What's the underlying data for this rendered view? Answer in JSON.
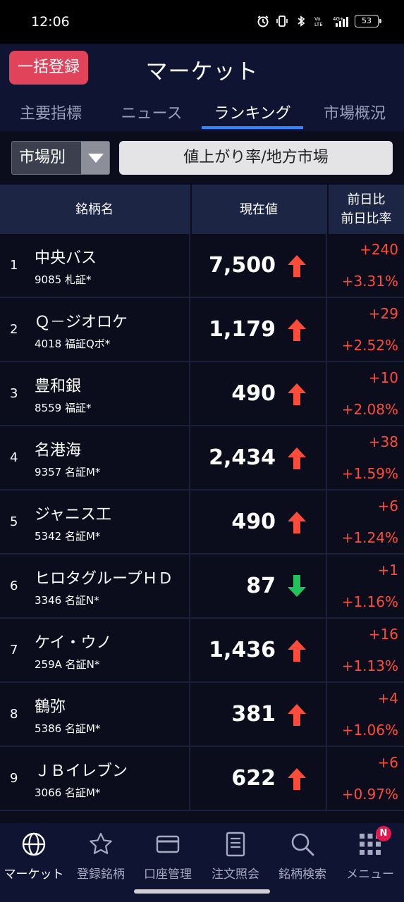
{
  "status": {
    "time": "12:06",
    "battery": "53",
    "network": "4G+"
  },
  "appbar": {
    "bulk_button": "一括登録",
    "title": "マーケット"
  },
  "tabs": [
    {
      "label": "主要指標"
    },
    {
      "label": "ニュース"
    },
    {
      "label": "ランキング"
    },
    {
      "label": "市場概況"
    }
  ],
  "filter": {
    "market_select": "市場別",
    "ranking_type": "値上がり率/地方市場"
  },
  "table": {
    "headers": {
      "name": "銘柄名",
      "price": "現在値",
      "change_line1": "前日比",
      "change_line2": "前日比率"
    },
    "rows": [
      {
        "rank": "1",
        "name": "中央バス",
        "code": "9085 札証*",
        "price": "7,500",
        "direction": "up",
        "change": "+240",
        "change_pct": "+3.31%"
      },
      {
        "rank": "2",
        "name": "Ｑ－ジオロケ",
        "code": "4018 福証Qボ*",
        "price": "1,179",
        "direction": "up",
        "change": "+29",
        "change_pct": "+2.52%"
      },
      {
        "rank": "3",
        "name": "豊和銀",
        "code": "8559 福証*",
        "price": "490",
        "direction": "up",
        "change": "+10",
        "change_pct": "+2.08%"
      },
      {
        "rank": "4",
        "name": "名港海",
        "code": "9357 名証M*",
        "price": "2,434",
        "direction": "up",
        "change": "+38",
        "change_pct": "+1.59%"
      },
      {
        "rank": "5",
        "name": "ジャニス工",
        "code": "5342 名証M*",
        "price": "490",
        "direction": "up",
        "change": "+6",
        "change_pct": "+1.24%"
      },
      {
        "rank": "6",
        "name": "ヒロタグループＨＤ",
        "code": "3346 名証N*",
        "price": "87",
        "direction": "down",
        "change": "+1",
        "change_pct": "+1.16%"
      },
      {
        "rank": "7",
        "name": "ケイ・ウノ",
        "code": "259A 名証N*",
        "price": "1,436",
        "direction": "up",
        "change": "+16",
        "change_pct": "+1.13%"
      },
      {
        "rank": "8",
        "name": "鶴弥",
        "code": "5386 名証M*",
        "price": "381",
        "direction": "up",
        "change": "+4",
        "change_pct": "+1.06%"
      },
      {
        "rank": "9",
        "name": "ＪＢイレブン",
        "code": "3066 名証M*",
        "price": "622",
        "direction": "up",
        "change": "+6",
        "change_pct": "+0.97%"
      }
    ]
  },
  "bottom_nav": [
    {
      "label": "マーケット",
      "icon": "globe-icon",
      "active": true
    },
    {
      "label": "登録銘柄",
      "icon": "star-icon"
    },
    {
      "label": "口座管理",
      "icon": "card-icon"
    },
    {
      "label": "注文照会",
      "icon": "document-icon"
    },
    {
      "label": "銘柄検索",
      "icon": "search-icon"
    },
    {
      "label": "メニュー",
      "icon": "grid-menu-icon",
      "badge": "N"
    }
  ],
  "colors": {
    "up": "#ff4b3a",
    "down": "#22c35a",
    "accent": "#2e86ff",
    "bulk_button": "#e1435a"
  }
}
